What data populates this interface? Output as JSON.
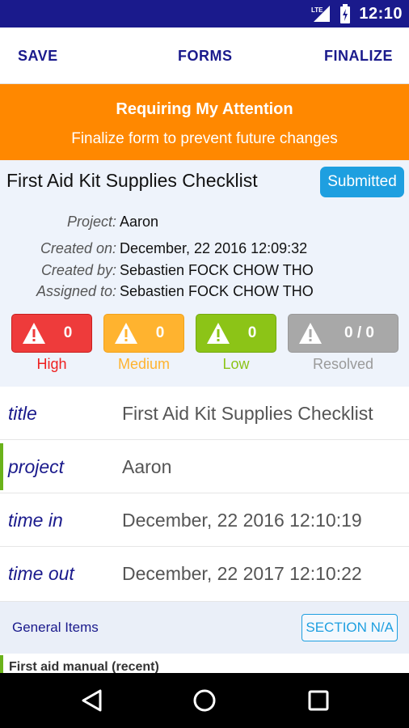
{
  "status_bar": {
    "network": "LTE",
    "time": "12:10"
  },
  "toolbar": {
    "save": "SAVE",
    "forms": "FORMS",
    "finalize": "FINALIZE"
  },
  "banner": {
    "title": "Requiring My Attention",
    "subtitle": "Finalize form to prevent future changes",
    "color": "#ff8800"
  },
  "form": {
    "title": "First Aid Kit Supplies Checklist",
    "status": "Submitted",
    "meta": [
      {
        "label": "Project:",
        "value": "Aaron"
      },
      {
        "label": "Created on:",
        "value": "December, 22 2016 12:09:32"
      },
      {
        "label": "Created by:",
        "value": "Sebastien FOCK CHOW THO"
      },
      {
        "label": "Assigned to:",
        "value": "Sebastien FOCK CHOW THO"
      }
    ]
  },
  "severity": [
    {
      "count": "0",
      "label": "High",
      "color": "#ee3b3b"
    },
    {
      "count": "0",
      "label": "Medium",
      "color": "#ffb32f"
    },
    {
      "count": "0",
      "label": "Low",
      "color": "#8cc417"
    },
    {
      "count": "0 / 0",
      "label": "Resolved",
      "color": "#a8a8a8"
    }
  ],
  "fields": [
    {
      "label": "title",
      "value": "First Aid Kit Supplies Checklist"
    },
    {
      "label": "project",
      "value": "Aaron"
    },
    {
      "label": "time in",
      "value": "December, 22 2016 12:10:19"
    },
    {
      "label": "time out",
      "value": "December, 22 2017 12:10:22"
    }
  ],
  "section": {
    "title": "General Items",
    "na_button": "SECTION N/A"
  },
  "items": [
    {
      "label": "First aid manual (recent)"
    }
  ],
  "nav": {
    "back": "back-icon",
    "home": "home-icon",
    "recent": "recent-apps-icon"
  }
}
